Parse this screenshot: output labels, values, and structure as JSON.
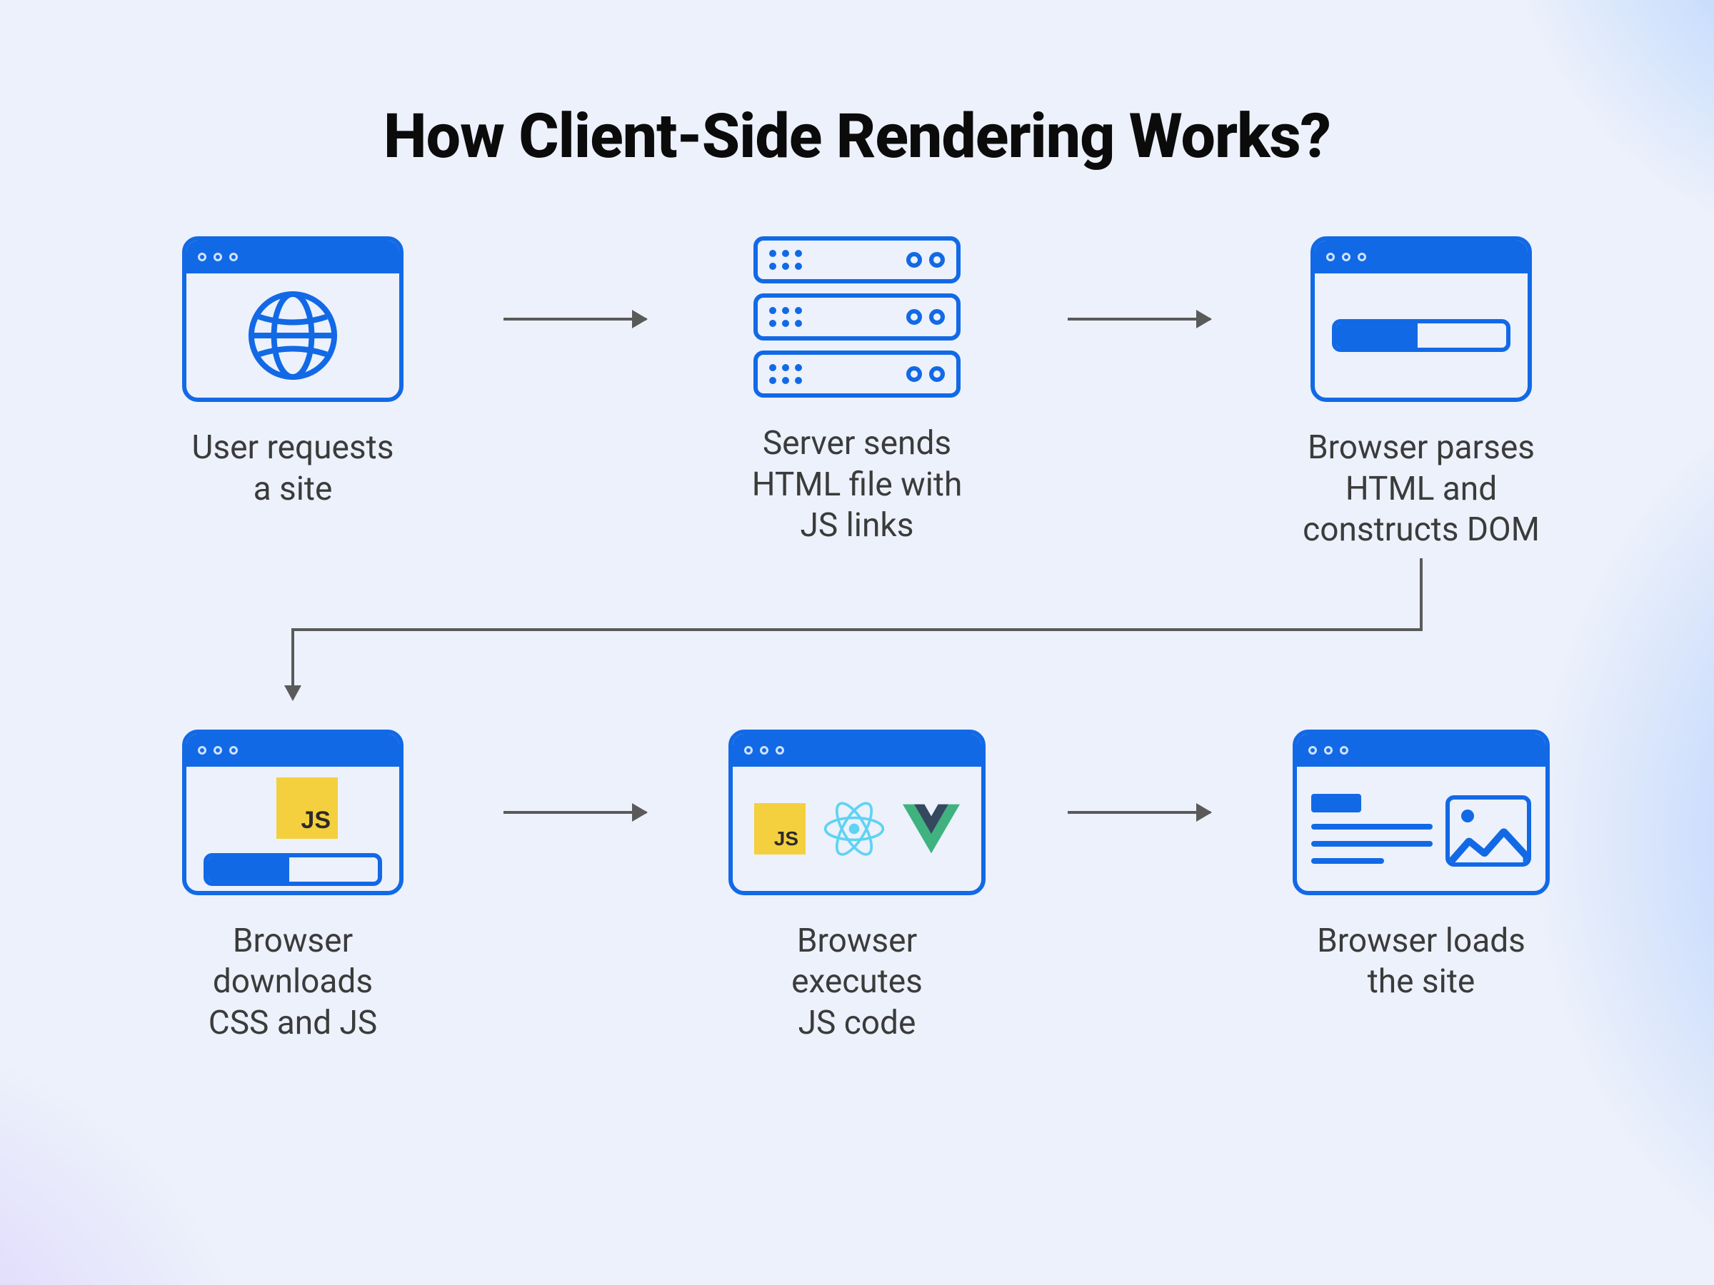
{
  "title": "How Client-Side Rendering Works?",
  "steps": [
    {
      "id": "user-requests",
      "label": "User requests\na site"
    },
    {
      "id": "server-sends",
      "label": "Server sends\nHTML file with\nJS links"
    },
    {
      "id": "browser-parses",
      "label": "Browser parses\nHTML and\nconstructs DOM"
    },
    {
      "id": "browser-downloads",
      "label": "Browser\ndownloads\nCSS and JS"
    },
    {
      "id": "browser-executes",
      "label": "Browser\nexecutes\nJS code"
    },
    {
      "id": "browser-loads",
      "label": "Browser loads\nthe site"
    }
  ],
  "icons": {
    "js_label": "JS"
  },
  "colors": {
    "accent": "#1269e6",
    "js_yellow": "#f4d03f",
    "react_cyan": "#5ed3f3",
    "vue_green": "#3fb27f",
    "vue_dark": "#34495e",
    "arrow": "#5a5a5a"
  }
}
